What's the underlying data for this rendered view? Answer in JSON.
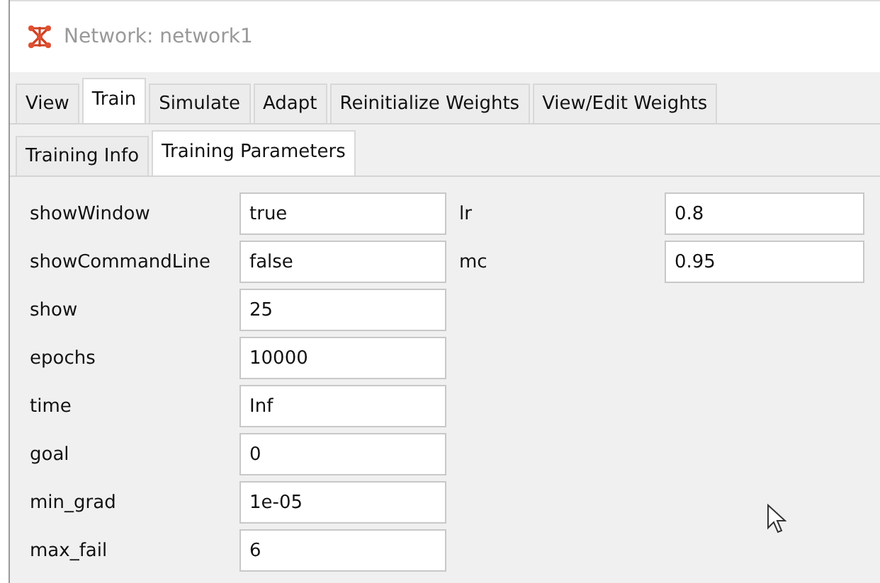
{
  "window": {
    "title": "Network: network1"
  },
  "tabs": [
    {
      "label": "View",
      "selected": false
    },
    {
      "label": "Train",
      "selected": true
    },
    {
      "label": "Simulate",
      "selected": false
    },
    {
      "label": "Adapt",
      "selected": false
    },
    {
      "label": "Reinitialize Weights",
      "selected": false
    },
    {
      "label": "View/Edit Weights",
      "selected": false
    }
  ],
  "subtabs": [
    {
      "label": "Training Info",
      "selected": false
    },
    {
      "label": "Training Parameters",
      "selected": true
    }
  ],
  "parameters_left": [
    {
      "label": "showWindow",
      "value": "true"
    },
    {
      "label": "showCommandLine",
      "value": "false"
    },
    {
      "label": "show",
      "value": "25"
    },
    {
      "label": "epochs",
      "value": "10000"
    },
    {
      "label": "time",
      "value": "Inf"
    },
    {
      "label": "goal",
      "value": "0"
    },
    {
      "label": "min_grad",
      "value": "1e-05"
    },
    {
      "label": "max_fail",
      "value": "6"
    }
  ],
  "parameters_right": [
    {
      "label": "lr",
      "value": "0.8"
    },
    {
      "label": "mc",
      "value": "0.95"
    }
  ]
}
